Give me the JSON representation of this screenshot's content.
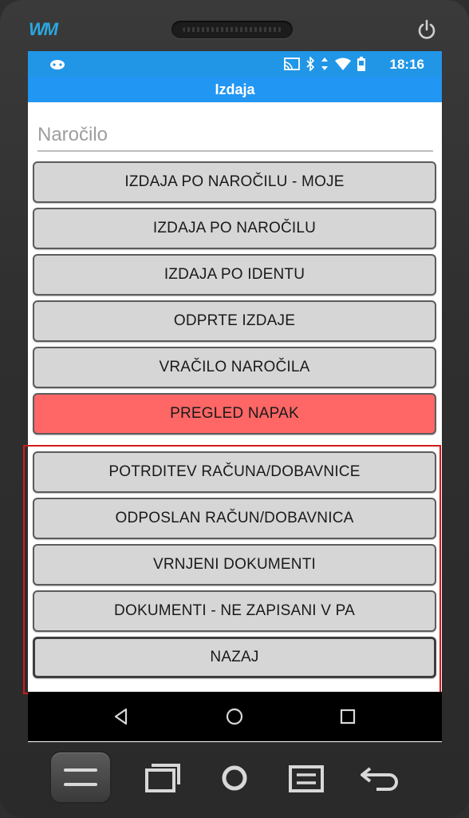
{
  "device": {
    "brand_logo": "WM",
    "icons": [
      "power-icon"
    ]
  },
  "status_bar": {
    "time": "18:16",
    "icons": [
      "gamepad-icon",
      "cast-icon",
      "bluetooth-icon",
      "data-arrows-icon",
      "wifi-icon",
      "battery-icon"
    ]
  },
  "app_bar": {
    "title": "Izdaja"
  },
  "order_field": {
    "placeholder": "Naročilo",
    "value": ""
  },
  "menu": {
    "items": [
      {
        "label": "IZDAJA PO NAROČILU - MOJE"
      },
      {
        "label": "IZDAJA PO NAROČILU"
      },
      {
        "label": "IZDAJA PO IDENTU"
      },
      {
        "label": "ODPRTE IZDAJE"
      },
      {
        "label": "VRAČILO NAROČILA"
      },
      {
        "label": "PREGLED NAPAK"
      },
      {
        "label": "POTRDITEV RAČUNA/DOBAVNICE"
      },
      {
        "label": "ODPOSLAN RAČUN/DOBAVNICA"
      },
      {
        "label": "VRNJENI DOKUMENTI"
      },
      {
        "label": "DOKUMENTI - NE ZAPISANI V PA"
      },
      {
        "label": "NAZAJ"
      }
    ]
  },
  "colors": {
    "status_bar": "#2196e6",
    "app_bar": "#2196f3",
    "button": "#d6d6d6",
    "error_button": "#ff6666",
    "highlight": "#d21b1b"
  },
  "nav_bar": {
    "icons": [
      "back-triangle-icon",
      "home-circle-icon",
      "recents-square-icon"
    ]
  },
  "hardware_buttons": {
    "icons": [
      "menu-lines-icon",
      "windows-icon",
      "home-icon",
      "list-icon",
      "return-icon"
    ]
  }
}
